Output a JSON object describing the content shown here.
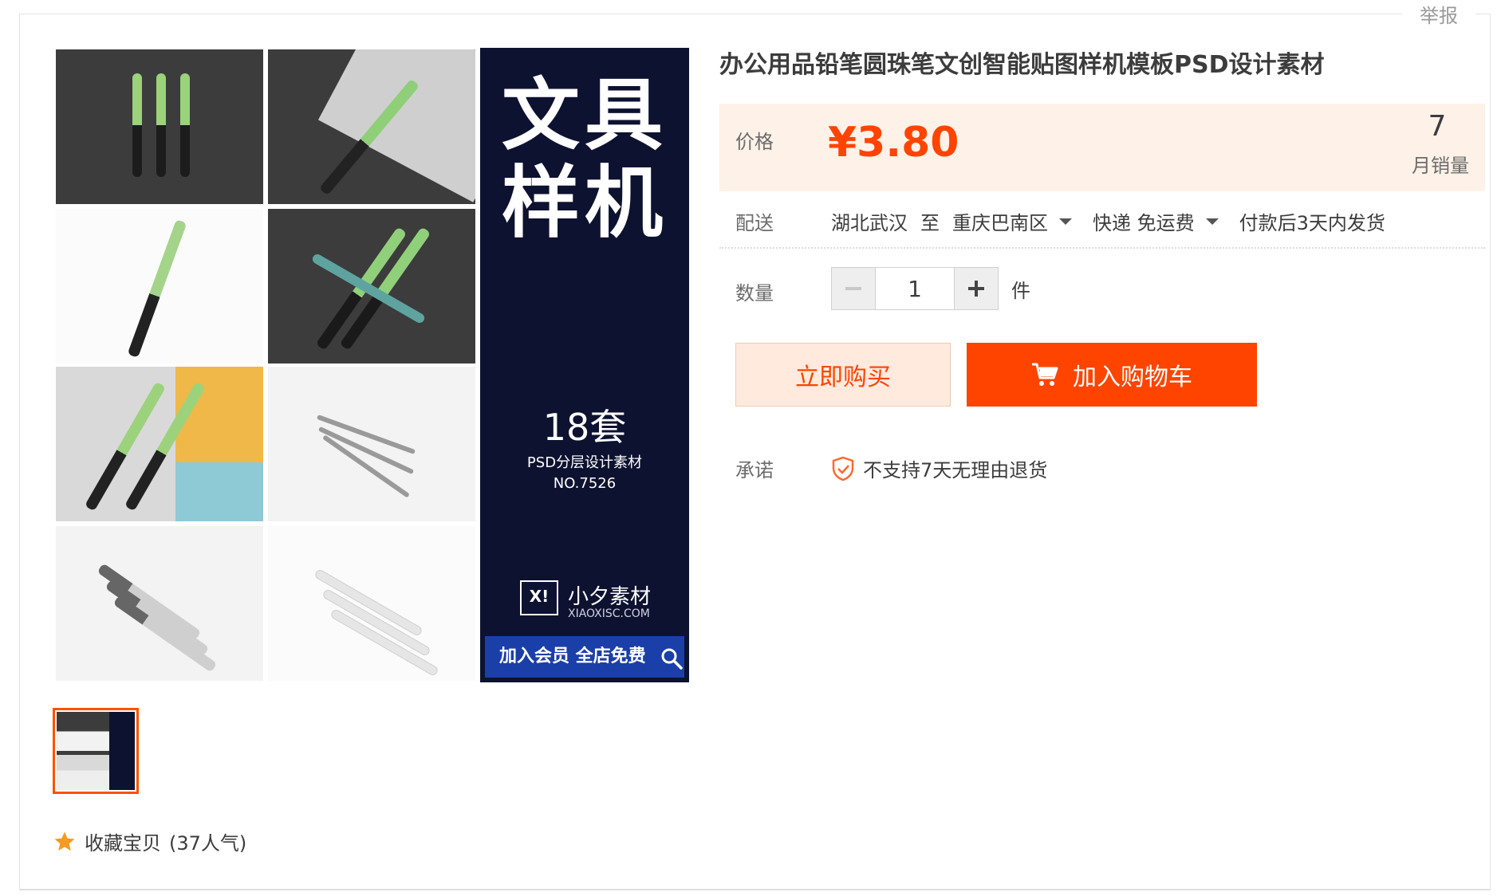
{
  "report_link": "举报",
  "gallery": {
    "banner_title_line1": "文具",
    "banner_title_line2": "样机",
    "banner_sets": "18套",
    "banner_subtitle": "PSD分层设计素材",
    "banner_number": "NO.7526",
    "brand_logo": "X!",
    "brand_name": "小夕素材",
    "brand_url": "XIAOXISC.COM",
    "vip_text": "加入会员 全店免费"
  },
  "favorite": {
    "label": "收藏宝贝",
    "popularity": "(37人气)"
  },
  "product": {
    "title": "办公用品铅笔圆珠笔文创智能贴图样机模板PSD设计素材",
    "price_label": "价格",
    "price": "¥3.80",
    "monthly_sales": "7",
    "monthly_sales_label": "月销量",
    "shipping_label": "配送",
    "ship_from": "湖北武汉",
    "ship_to_word": "至",
    "ship_to": "重庆巴南区",
    "ship_method": "快递 免运费",
    "ship_time": "付款后3天内发货",
    "quantity_label": "数量",
    "quantity": "1",
    "quantity_unit": "件",
    "buy_now": "立即购买",
    "add_to_cart": "加入购物车",
    "promise_label": "承诺",
    "promise_text": "不支持7天无理由退货"
  },
  "colors": {
    "accent": "#ff4400",
    "price_bg": "#fef2e8",
    "banner_bg": "#0d1230"
  },
  "icons": [
    "zoom-icon",
    "star-icon",
    "minus-icon",
    "plus-icon",
    "cart-icon",
    "shield-check-icon",
    "dropdown-arrow-icon"
  ]
}
